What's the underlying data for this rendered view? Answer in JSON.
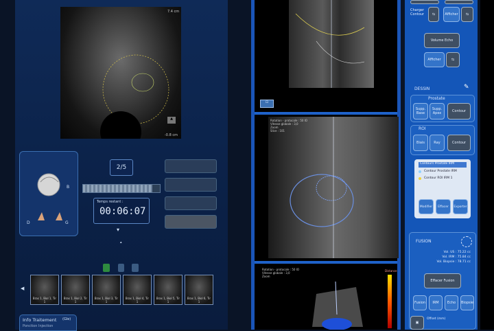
{
  "left": {
    "scale_top": "7.4 cm",
    "scale_bottom": "-0.8 cm",
    "counter": "2/5",
    "progress_pct": 90,
    "timer_label": "Temps restant :",
    "timer_value": "00:06:07",
    "orientation_letters": [
      "B",
      "D",
      "G"
    ],
    "thumbnails": [
      "Bras 1, Biol 1, Tir 1",
      "Bras 1, Biol 2, Tir 1",
      "Bras 1, Biol 3, Tir 1",
      "Bras 1, Biol 4, Tir 1",
      "Bras 1, Biol 5, Tir 1",
      "Bras 1, Biol 6, Tir 1"
    ],
    "info_tab": "Info Traitement",
    "info_tab_badge": "(Gle)",
    "info_sub": "Ponction Injection"
  },
  "middle": {
    "pane2_meta": [
      "Rotation - protocole : 50 IO",
      "Vitesse globale : 3,0",
      "Zoom",
      "Slice : 101"
    ],
    "pane3_meta": [
      "Rotation - protocole : 50 IO",
      "Vitesse globale : 3,0",
      "Zoom"
    ],
    "distance_label": "Distance"
  },
  "right": {
    "charger_label": "Charger Contour",
    "afficher_top": "Afficher",
    "volume_echo": "Volume Echo",
    "afficher_mid": "Afficher",
    "dessin": "DESSIN",
    "prostate": "Prostate",
    "prostate_buttons": [
      "Supp. Base",
      "Supp. Apex",
      "Contour"
    ],
    "roi": "ROI",
    "roi_buttons": [
      "Biais",
      "Ray",
      "Contour"
    ],
    "legend_title": "Contours Prostate IRM",
    "legend_items": [
      "Contour Prostate IRM",
      "Contour ROI IRM 1"
    ],
    "legend_buttons": [
      "Modifier",
      "Effacer",
      "Exporter"
    ],
    "fusion": "FUSION",
    "fusion_vols": [
      "Vol. US : 75.22 cc",
      "Vol. IRM : 75.84 cc",
      "Vol. Biopsie : 78.71 cc"
    ],
    "effacer_fusion": "Effacer Fusion",
    "fusion_buttons": [
      "Fusion",
      "IRM",
      "Echo",
      "Biopsie"
    ],
    "offset_label": "Offset (mm)"
  },
  "colors": {
    "accent": "#1456b8",
    "panel": "#0f2a57",
    "legend_dot_1": "#8fd0ff",
    "legend_dot_2": "#f2d33b"
  }
}
